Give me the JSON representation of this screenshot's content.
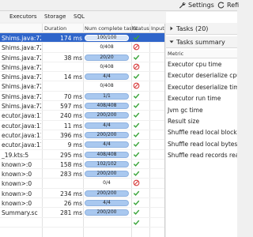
{
  "toolbar": {
    "settings_label": "Settings",
    "refresh_label": "Refi"
  },
  "tabs": [
    "Executors",
    "Storage",
    "SQL"
  ],
  "grid": {
    "columns": [
      "Duration",
      "Num complete tasks",
      "Status",
      "Input"
    ],
    "rows": [
      {
        "name": "Shims.java:72",
        "duration": "174 ms",
        "progress": "100/100",
        "fraction": 1.0,
        "status": "ok",
        "selected": true
      },
      {
        "name": "Shims.java:72",
        "duration": "",
        "progress": "0/408",
        "fraction": 0.0,
        "status": "fail",
        "selected": false
      },
      {
        "name": "Shims.java:72",
        "duration": "38 ms",
        "progress": "20/20",
        "fraction": 1.0,
        "status": "ok",
        "selected": false
      },
      {
        "name": "Shims.java:72",
        "duration": "",
        "progress": "0/408",
        "fraction": 0.0,
        "status": "fail",
        "selected": false
      },
      {
        "name": "Shims.java:72",
        "duration": "14 ms",
        "progress": "4/4",
        "fraction": 1.0,
        "status": "ok",
        "selected": false
      },
      {
        "name": "Shims.java:72",
        "duration": "",
        "progress": "0/408",
        "fraction": 0.0,
        "status": "fail",
        "selected": false
      },
      {
        "name": "Shims.java:72",
        "duration": "70 ms",
        "progress": "1/1",
        "fraction": 1.0,
        "status": "ok",
        "selected": false
      },
      {
        "name": "Shims.java:72",
        "duration": "597 ms",
        "progress": "408/408",
        "fraction": 1.0,
        "status": "ok",
        "selected": false
      },
      {
        "name": "ecutor.java:11",
        "duration": "240 ms",
        "progress": "200/200",
        "fraction": 1.0,
        "status": "ok",
        "selected": false
      },
      {
        "name": "ecutor.java:11",
        "duration": "11 ms",
        "progress": "4/4",
        "fraction": 1.0,
        "status": "ok",
        "selected": false
      },
      {
        "name": "ecutor.java:11",
        "duration": "396 ms",
        "progress": "200/200",
        "fraction": 1.0,
        "status": "ok",
        "selected": false
      },
      {
        "name": "ecutor.java:11",
        "duration": "9 ms",
        "progress": "4/4",
        "fraction": 1.0,
        "status": "ok",
        "selected": false
      },
      {
        "name": "_19.kts:5",
        "duration": "295 ms",
        "progress": "408/408",
        "fraction": 1.0,
        "status": "ok",
        "selected": false
      },
      {
        "name": "known>:0",
        "duration": "158 ms",
        "progress": "102/102",
        "fraction": 1.0,
        "status": "ok",
        "selected": false
      },
      {
        "name": "known>:0",
        "duration": "283 ms",
        "progress": "200/200",
        "fraction": 1.0,
        "status": "ok",
        "selected": false
      },
      {
        "name": "known>:0",
        "duration": "",
        "progress": "0/4",
        "fraction": 0.0,
        "status": "fail",
        "selected": false
      },
      {
        "name": "known>:0",
        "duration": "234 ms",
        "progress": "200/200",
        "fraction": 1.0,
        "status": "ok",
        "selected": false
      },
      {
        "name": "known>:0",
        "duration": "26 ms",
        "progress": "4/4",
        "fraction": 1.0,
        "status": "ok",
        "selected": false
      },
      {
        "name": "Summary.sc",
        "duration": "281 ms",
        "progress": "200/200",
        "fraction": 1.0,
        "status": "ok",
        "selected": false
      },
      {
        "name": "",
        "duration": "",
        "progress": "",
        "fraction": 1.0,
        "status": "ok",
        "selected": false
      }
    ]
  },
  "right_panel": {
    "tasks_title": "Tasks (20)",
    "summary_title": "Tasks summary",
    "metric_header": "Metric",
    "metrics": [
      "Executor cpu time",
      "Executor deserialize cpu ti",
      "Executor deserialize time",
      "Executor run time",
      "Jvm gc time",
      "Result size",
      "Shuffle read local blocks f",
      "Shuffle read local bytes re",
      "Shuffle read records read"
    ]
  },
  "colors": {
    "selection": "#2f65ca",
    "bar_fill": "#a9c8ef",
    "ok_green": "#3aa53a",
    "fail_red": "#d83a3a"
  },
  "icons": {
    "settings": "wrench-icon",
    "refresh": "refresh-icon",
    "ok": "check-icon",
    "fail": "no-entry-icon"
  }
}
